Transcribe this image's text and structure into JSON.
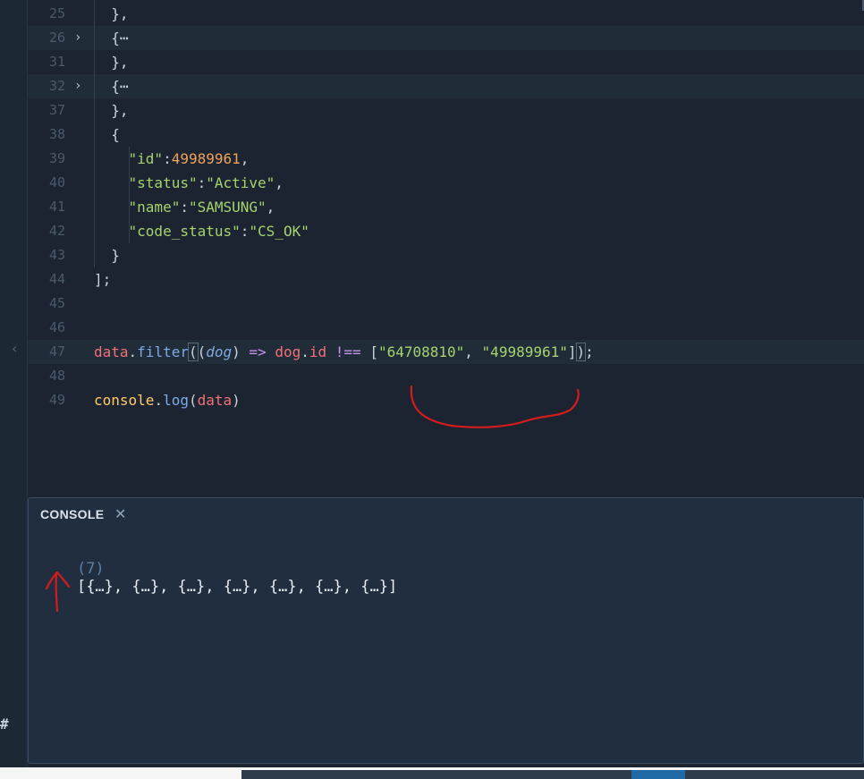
{
  "editor": {
    "lines": [
      {
        "num": "25",
        "fold": "",
        "hl": false,
        "tokens": [
          {
            "t": "  },",
            "c": "k-pun"
          }
        ]
      },
      {
        "num": "26",
        "fold": "›",
        "hl": true,
        "tokens": [
          {
            "t": "  {",
            "c": "k-pun"
          },
          {
            "t": "⋯",
            "c": "k-pun"
          }
        ]
      },
      {
        "num": "31",
        "fold": "",
        "hl": false,
        "tokens": [
          {
            "t": "  },",
            "c": "k-pun"
          }
        ]
      },
      {
        "num": "32",
        "fold": "›",
        "hl": true,
        "tokens": [
          {
            "t": "  {",
            "c": "k-pun"
          },
          {
            "t": "⋯",
            "c": "k-pun"
          }
        ]
      },
      {
        "num": "37",
        "fold": "",
        "hl": false,
        "tokens": [
          {
            "t": "  },",
            "c": "k-pun"
          }
        ]
      },
      {
        "num": "38",
        "fold": "",
        "hl": false,
        "tokens": [
          {
            "t": "  {",
            "c": "k-pun"
          }
        ]
      },
      {
        "num": "39",
        "fold": "",
        "hl": false,
        "tokens": [
          {
            "t": "    ",
            "c": "k-pun"
          },
          {
            "t": "\"id\"",
            "c": "k-str"
          },
          {
            "t": ":",
            "c": "k-pun"
          },
          {
            "t": "49989961",
            "c": "k-num"
          },
          {
            "t": ",",
            "c": "k-pun"
          }
        ]
      },
      {
        "num": "40",
        "fold": "",
        "hl": false,
        "tokens": [
          {
            "t": "    ",
            "c": "k-pun"
          },
          {
            "t": "\"status\"",
            "c": "k-str"
          },
          {
            "t": ":",
            "c": "k-pun"
          },
          {
            "t": "\"Active\"",
            "c": "k-str"
          },
          {
            "t": ",",
            "c": "k-pun"
          }
        ]
      },
      {
        "num": "41",
        "fold": "",
        "hl": false,
        "tokens": [
          {
            "t": "    ",
            "c": "k-pun"
          },
          {
            "t": "\"name\"",
            "c": "k-str"
          },
          {
            "t": ":",
            "c": "k-pun"
          },
          {
            "t": "\"SAMSUNG\"",
            "c": "k-str"
          },
          {
            "t": ",",
            "c": "k-pun"
          }
        ]
      },
      {
        "num": "42",
        "fold": "",
        "hl": false,
        "tokens": [
          {
            "t": "    ",
            "c": "k-pun"
          },
          {
            "t": "\"code_status\"",
            "c": "k-str"
          },
          {
            "t": ":",
            "c": "k-pun"
          },
          {
            "t": "\"CS_OK\"",
            "c": "k-str"
          }
        ]
      },
      {
        "num": "43",
        "fold": "",
        "hl": false,
        "tokens": [
          {
            "t": "  }",
            "c": "k-pun"
          }
        ]
      },
      {
        "num": "44",
        "fold": "",
        "hl": false,
        "tokens": [
          {
            "t": "];",
            "c": "k-pun"
          }
        ]
      },
      {
        "num": "45",
        "fold": "",
        "hl": false,
        "tokens": []
      },
      {
        "num": "46",
        "fold": "",
        "hl": false,
        "tokens": []
      },
      {
        "num": "47",
        "fold": "",
        "hl": true,
        "tokens": [
          {
            "t": "data",
            "c": "k-var"
          },
          {
            "t": ".",
            "c": "k-pun"
          },
          {
            "t": "filter",
            "c": "k-fn"
          },
          {
            "t": "(",
            "c": "k-pun bracket-box"
          },
          {
            "t": "(",
            "c": "k-pun"
          },
          {
            "t": "dog",
            "c": "k-par"
          },
          {
            "t": ") ",
            "c": "k-pun"
          },
          {
            "t": "=>",
            "c": "k-op"
          },
          {
            "t": " ",
            "c": "k-pun"
          },
          {
            "t": "dog",
            "c": "k-var"
          },
          {
            "t": ".",
            "c": "k-pun"
          },
          {
            "t": "id",
            "c": "k-var"
          },
          {
            "t": " ",
            "c": "k-pun"
          },
          {
            "t": "!==",
            "c": "k-op"
          },
          {
            "t": " [",
            "c": "k-pun"
          },
          {
            "t": "\"64708810\"",
            "c": "k-str"
          },
          {
            "t": ", ",
            "c": "k-pun"
          },
          {
            "t": "\"49989961\"",
            "c": "k-str"
          },
          {
            "t": "]",
            "c": "k-pun"
          },
          {
            "t": ")",
            "c": "k-pun bracket-box"
          },
          {
            "t": ";",
            "c": "k-pun"
          }
        ]
      },
      {
        "num": "48",
        "fold": "",
        "hl": false,
        "tokens": []
      },
      {
        "num": "49",
        "fold": "",
        "hl": false,
        "tokens": [
          {
            "t": "console",
            "c": "k-con"
          },
          {
            "t": ".",
            "c": "k-pun"
          },
          {
            "t": "log",
            "c": "k-fn"
          },
          {
            "t": "(",
            "c": "k-pun"
          },
          {
            "t": "data",
            "c": "k-var"
          },
          {
            "t": ")",
            "c": "k-pun"
          }
        ]
      }
    ]
  },
  "console": {
    "title": "CONSOLE",
    "close_glyph": "✕",
    "count": "(7)",
    "output": "[{…}, {…}, {…}, {…}, {…}, {…}, {…}]"
  },
  "sidebar": {
    "collapse_glyph": "‹",
    "hash_glyph": "#"
  }
}
